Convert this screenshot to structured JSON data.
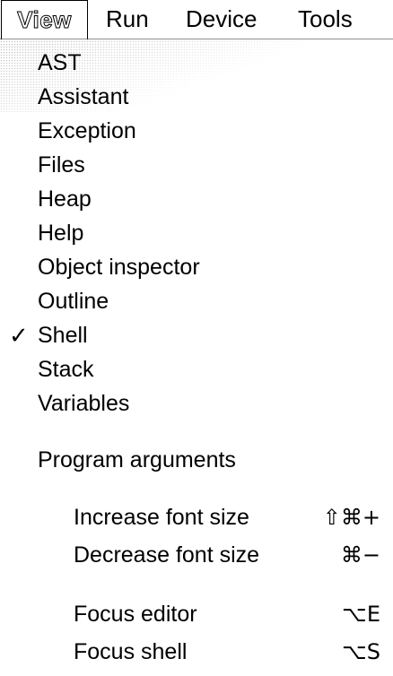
{
  "menubar": {
    "view": "View",
    "run": "Run",
    "device": "Device",
    "tools": "Tools"
  },
  "view_menu": {
    "panels": [
      {
        "label": "AST",
        "checked": false
      },
      {
        "label": "Assistant",
        "checked": false
      },
      {
        "label": "Exception",
        "checked": false
      },
      {
        "label": "Files",
        "checked": false
      },
      {
        "label": "Heap",
        "checked": false
      },
      {
        "label": "Help",
        "checked": false
      },
      {
        "label": "Object inspector",
        "checked": false
      },
      {
        "label": "Outline",
        "checked": false
      },
      {
        "label": "Shell",
        "checked": true
      },
      {
        "label": "Stack",
        "checked": false
      },
      {
        "label": "Variables",
        "checked": false
      }
    ],
    "check_mark": "✓",
    "program_arguments": "Program arguments",
    "increase_font": {
      "label": "Increase font size",
      "shortcut": "⇧⌘+"
    },
    "decrease_font": {
      "label": "Decrease font size",
      "shortcut": "⌘−"
    },
    "focus_editor": {
      "label": "Focus editor",
      "shortcut": "⌥E"
    },
    "focus_shell": {
      "label": "Focus shell",
      "shortcut": "⌥S"
    }
  }
}
